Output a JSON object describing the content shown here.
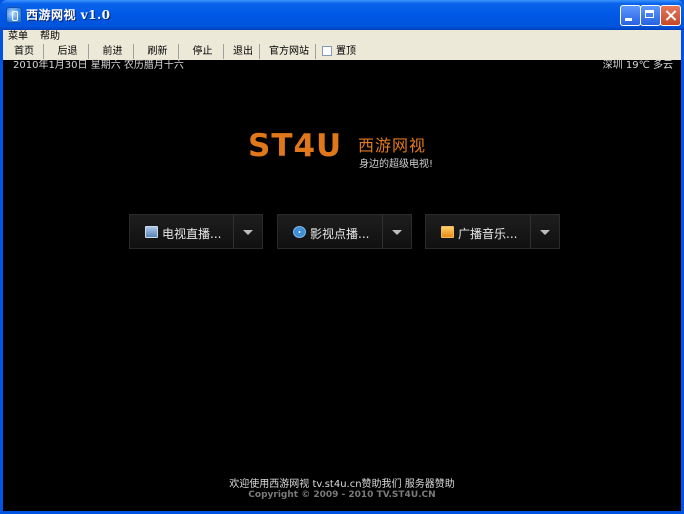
{
  "window": {
    "title": "西游网视 v1.0"
  },
  "menu": [
    "菜单",
    "帮助"
  ],
  "toolbar": {
    "buttons": [
      "首页",
      "后退",
      "前进",
      "刷新",
      "停止",
      "退出",
      "官方网站"
    ],
    "checkbox_label": "置顶"
  },
  "status": {
    "date": "2010年1月30日 星期六 农历腊月十六",
    "city": "深圳",
    "weather": "19℃ 多云"
  },
  "logo": {
    "brand": "ST4U",
    "cn": "西游网视",
    "tagline": "身边的超级电视!"
  },
  "dropdowns": [
    {
      "label": "电视直播...",
      "icon": "tv-icon"
    },
    {
      "label": "影视点播...",
      "icon": "film-icon"
    },
    {
      "label": "广播音乐...",
      "icon": "radio-icon"
    }
  ],
  "footer": {
    "welcome": "欢迎使用西游网视",
    "site": "tv.st4u.cn",
    "sponsor": "赞助我们",
    "server": "服务器赞助",
    "copyright": "Copyright © 2009 - 2010 TV.ST4U.CN"
  }
}
